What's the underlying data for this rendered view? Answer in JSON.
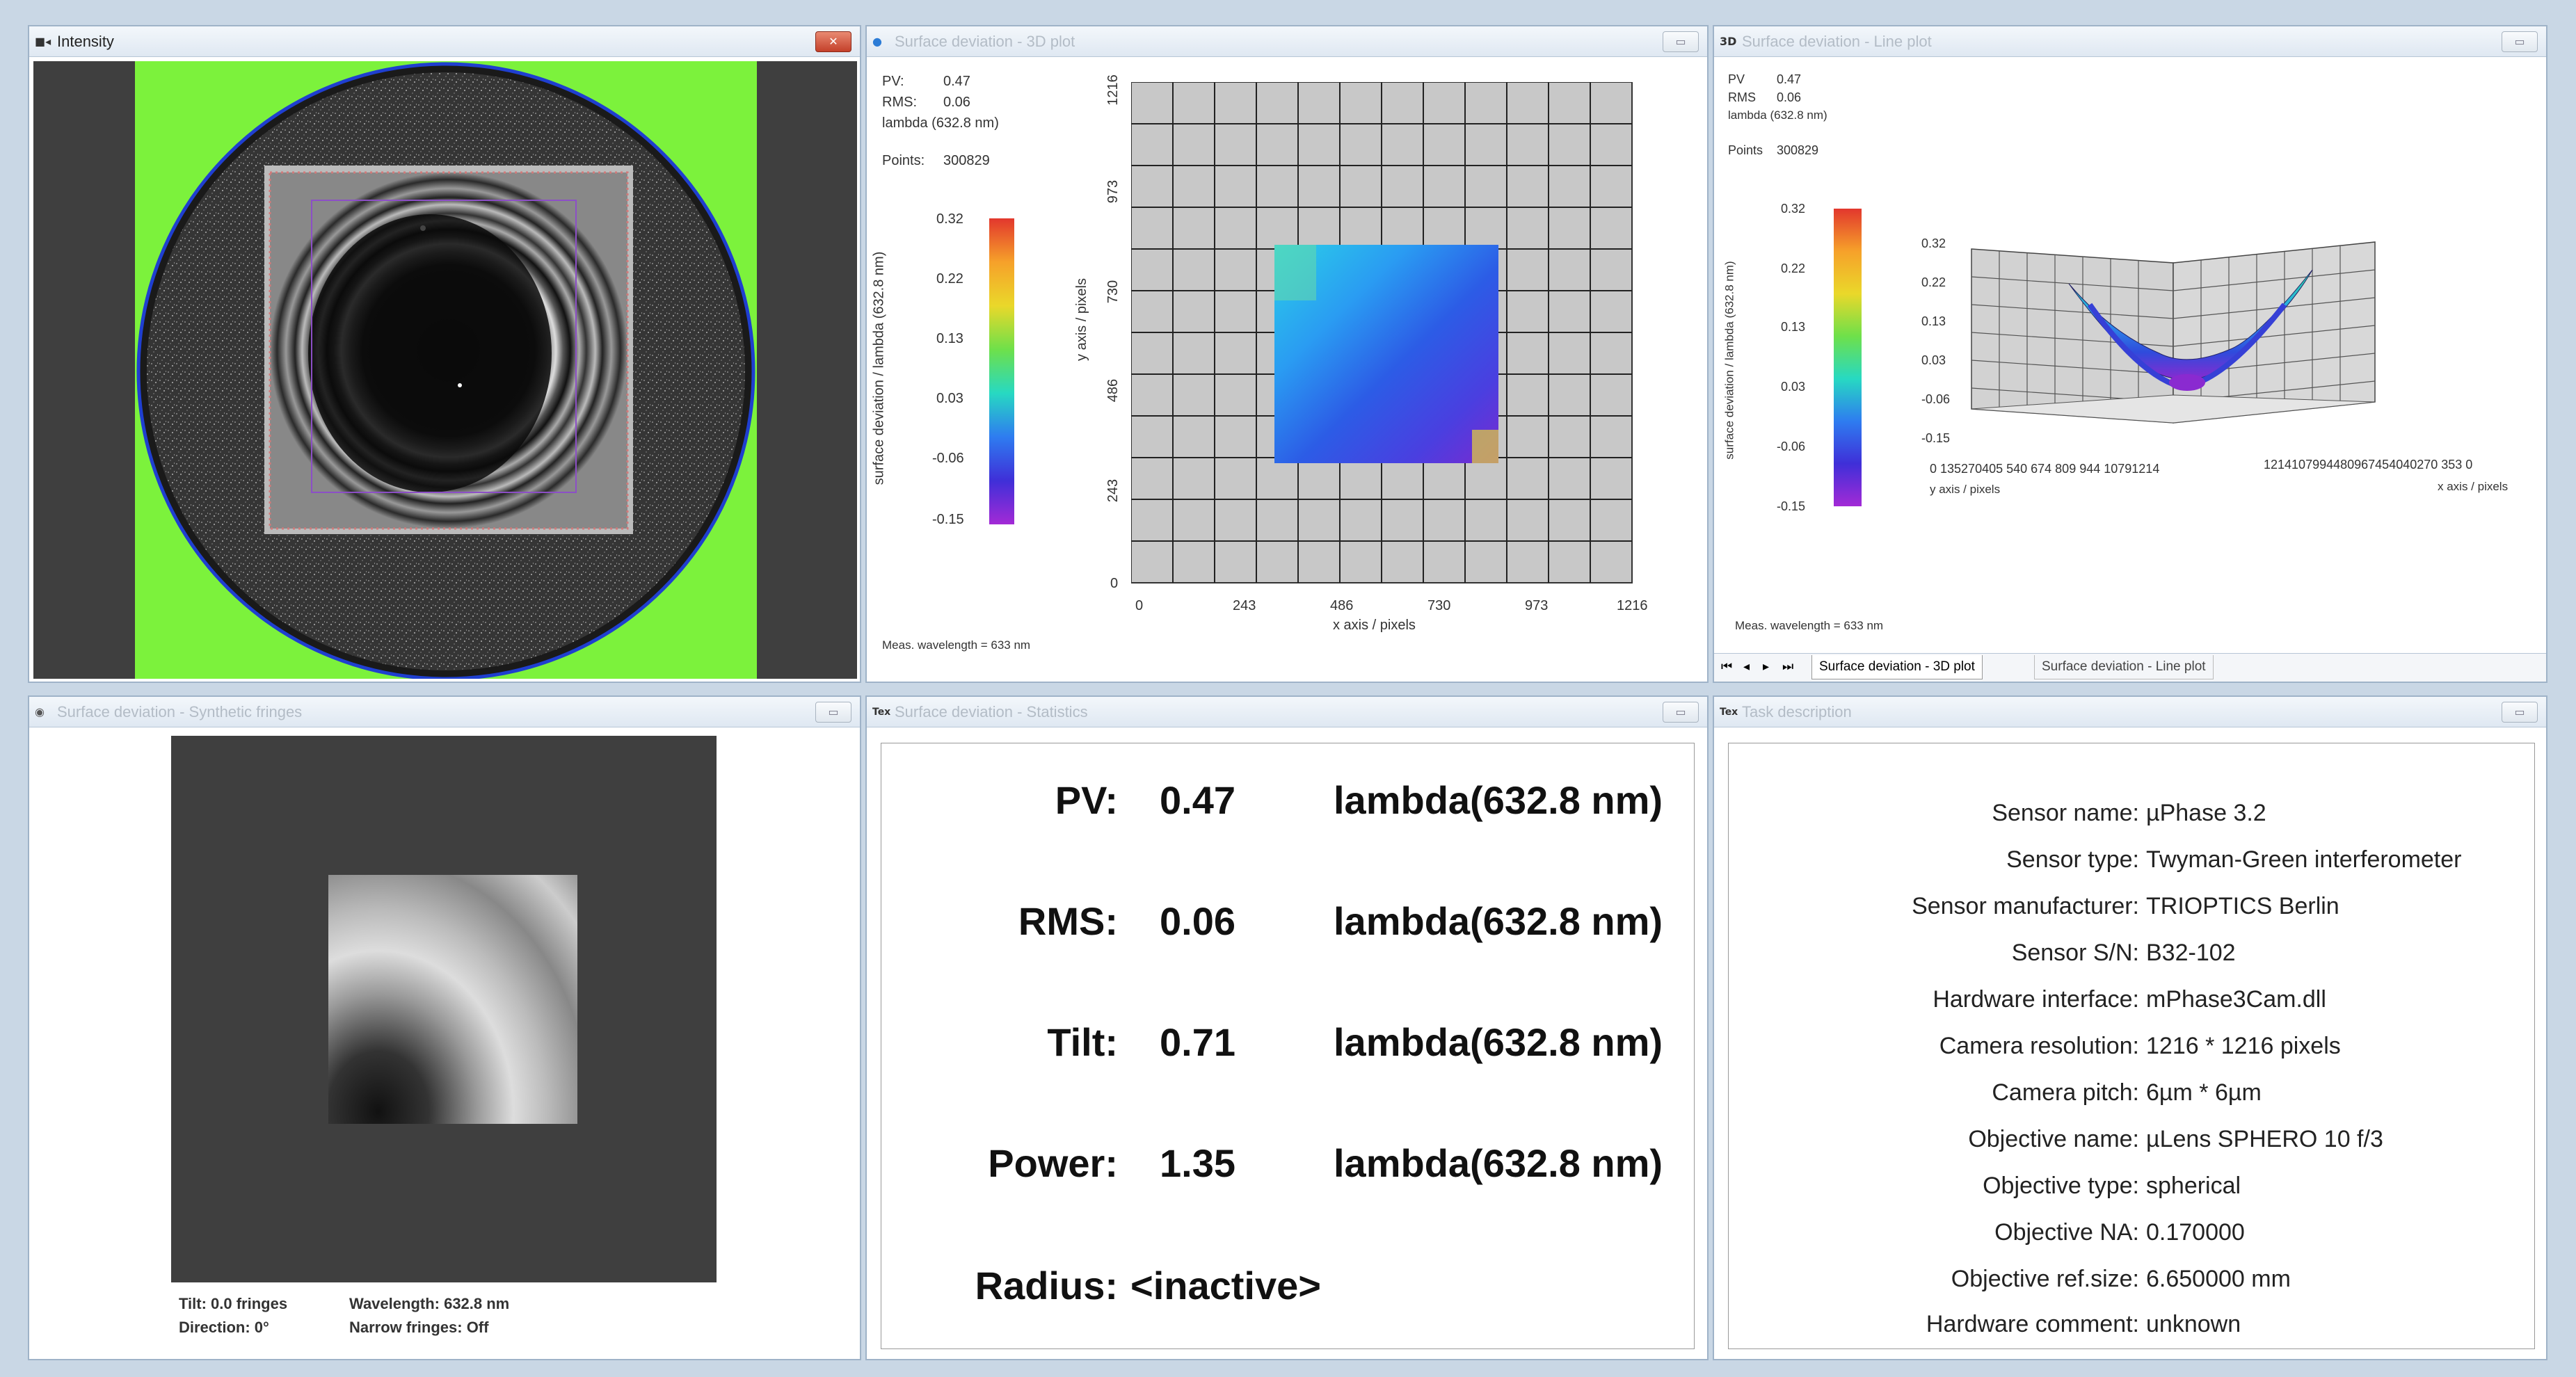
{
  "intensity": {
    "title": "Intensity",
    "icon": "camera-icon"
  },
  "plot3d_2d": {
    "title": "Surface deviation - 3D plot",
    "pv_label": "PV:",
    "pv_value": "0.47",
    "rms_label": "RMS:",
    "rms_value": "0.06",
    "unit": "lambda (632.8 nm)",
    "points_label": "Points:",
    "points_value": "300829",
    "colorbar_label": "surface deviation / lambda (632.8 nm)",
    "colorbar_ticks": [
      "0.32",
      "0.22",
      "0.13",
      "0.03",
      "-0.06",
      "-0.15"
    ],
    "yaxis_label": "y axis / pixels",
    "xaxis_label": "x axis / pixels",
    "y_ticks": [
      "1216",
      "973",
      "730",
      "486",
      "243",
      "0"
    ],
    "x_ticks": [
      "0",
      "243",
      "486",
      "730",
      "973",
      "1216"
    ],
    "footer": "Meas. wavelength = 633 nm"
  },
  "lineplot": {
    "title": "Surface deviation - Line plot",
    "icon_text": "3D",
    "pv_label": "PV",
    "pv_value": "0.47",
    "rms_label": "RMS",
    "rms_value": "0.06",
    "unit": "lambda (632.8 nm)",
    "points_label": "Points",
    "points_value": "300829",
    "colorbar_label": "surface deviation / lambda (632.8 nm)",
    "colorbar_ticks": [
      "0.32",
      "0.22",
      "0.13",
      "0.03",
      "-0.06",
      "-0.15"
    ],
    "z_ticks": [
      "0.32",
      "0.22",
      "0.13",
      "0.03",
      "-0.06",
      "-0.15"
    ],
    "y_ticks_text": "0 135270405 540 674 809 944 10791214",
    "x_ticks_text": "1214107994480967454040270 353 0",
    "yaxis_label": "y axis / pixels",
    "xaxis_label": "x axis / pixels",
    "footer": "Meas. wavelength = 633 nm",
    "tabs": [
      "Surface deviation - 3D plot",
      "Surface deviation - Line plot"
    ]
  },
  "synthetic": {
    "title": "Surface deviation - Synthetic fringes",
    "tilt": "Tilt: 0.0 fringes",
    "direction": "Direction: 0°",
    "wavelength": "Wavelength: 632.8 nm",
    "narrow": "Narrow fringes: Off"
  },
  "statistics": {
    "title": "Surface deviation - Statistics",
    "rows": [
      {
        "label": "PV:",
        "value": "0.47",
        "unit": "lambda(632.8 nm)"
      },
      {
        "label": "RMS:",
        "value": "0.06",
        "unit": "lambda(632.8 nm)"
      },
      {
        "label": "Tilt:",
        "value": "0.71",
        "unit": "lambda(632.8 nm)"
      },
      {
        "label": "Power:",
        "value": "1.35",
        "unit": "lambda(632.8 nm)"
      }
    ],
    "radius_label": "Radius:",
    "radius_value": "<inactive>"
  },
  "description": {
    "title": "Task description",
    "rows": [
      {
        "key": "Sensor name:",
        "value": "µPhase 3.2"
      },
      {
        "key": "Sensor type:",
        "value": "Twyman-Green interferometer"
      },
      {
        "key": "Sensor manufacturer:",
        "value": "TRIOPTICS Berlin"
      },
      {
        "key": "Sensor S/N:",
        "value": "B32-102"
      },
      {
        "key": "Hardware interface:",
        "value": "mPhase3Cam.dll"
      },
      {
        "key": "Camera resolution:",
        "value": "1216 * 1216 pixels"
      },
      {
        "key": "Camera pitch:",
        "value": "6µm * 6µm"
      },
      {
        "key": "Objective name:",
        "value": "µLens SPHERO 10 f/3"
      },
      {
        "key": "Objective type:",
        "value": "spherical"
      },
      {
        "key": "Objective NA:",
        "value": "0.170000"
      },
      {
        "key": "Objective ref.size:",
        "value": "6.650000 mm"
      },
      {
        "key": "Hardware comment:",
        "value": "unknown"
      }
    ]
  },
  "colors": {
    "green_bg": "#7cf23c",
    "dark_bg": "#3f3f3f",
    "grid_bg": "#c8c8c8"
  }
}
